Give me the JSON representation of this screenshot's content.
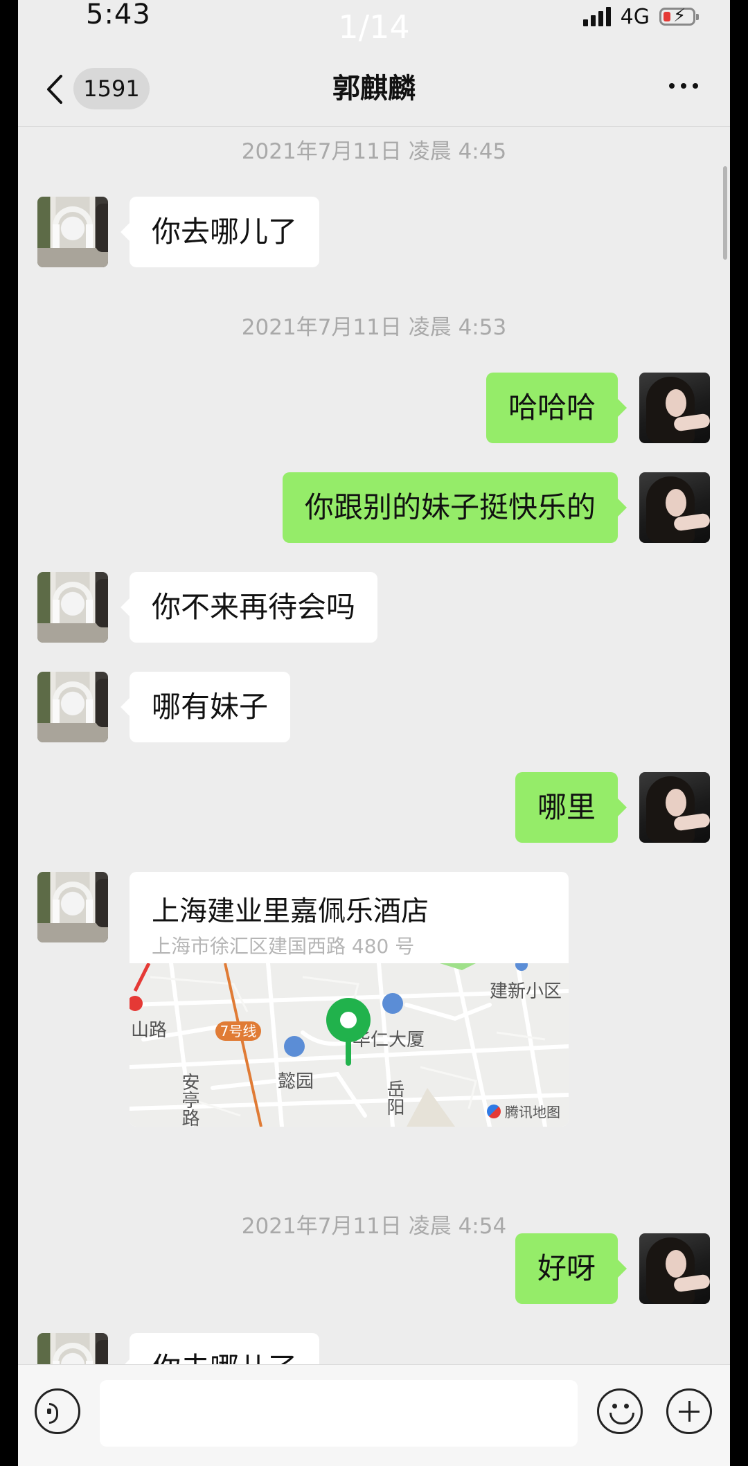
{
  "status_bar": {
    "time": "5:43",
    "photo_counter": "1/14",
    "network": "4G"
  },
  "nav": {
    "unread_count": "1591",
    "title": "郭麒麟"
  },
  "timestamps": [
    "2021年7月11日 凌晨 4:45",
    "2021年7月11日 凌晨 4:53",
    "2021年7月11日 凌晨 4:54"
  ],
  "messages": [
    {
      "side": "left",
      "text": "你去哪儿了"
    },
    {
      "side": "right",
      "text": "哈哈哈"
    },
    {
      "side": "right",
      "text": "你跟别的妹子挺快乐的"
    },
    {
      "side": "left",
      "text": "你不来再待会吗"
    },
    {
      "side": "left",
      "text": "哪有妹子"
    },
    {
      "side": "right",
      "text": "哪里"
    },
    {
      "side": "right",
      "text": "好呀"
    },
    {
      "side": "left",
      "text": "你去哪儿了"
    }
  ],
  "location": {
    "title": "上海建业里嘉佩乐酒店",
    "address": "上海市徐汇区建国西路 480 号",
    "map_labels": {
      "road_left": "山路",
      "metro_line": "7号线",
      "building": "华仁大厦",
      "community": "建新小区",
      "park": "懿园",
      "street_an": "安亭路",
      "street_yue": "岳阳",
      "provider": "腾讯地图"
    }
  },
  "icons": {
    "back": "chevron-left-icon",
    "more": "more-icon",
    "voice": "voice-icon",
    "emoji": "emoji-icon",
    "plus": "plus-icon"
  },
  "colors": {
    "chat_background": "#ededed",
    "sent_bubble": "#95ec69",
    "received_bubble": "#ffffff",
    "map_pin": "#21b24c"
  }
}
